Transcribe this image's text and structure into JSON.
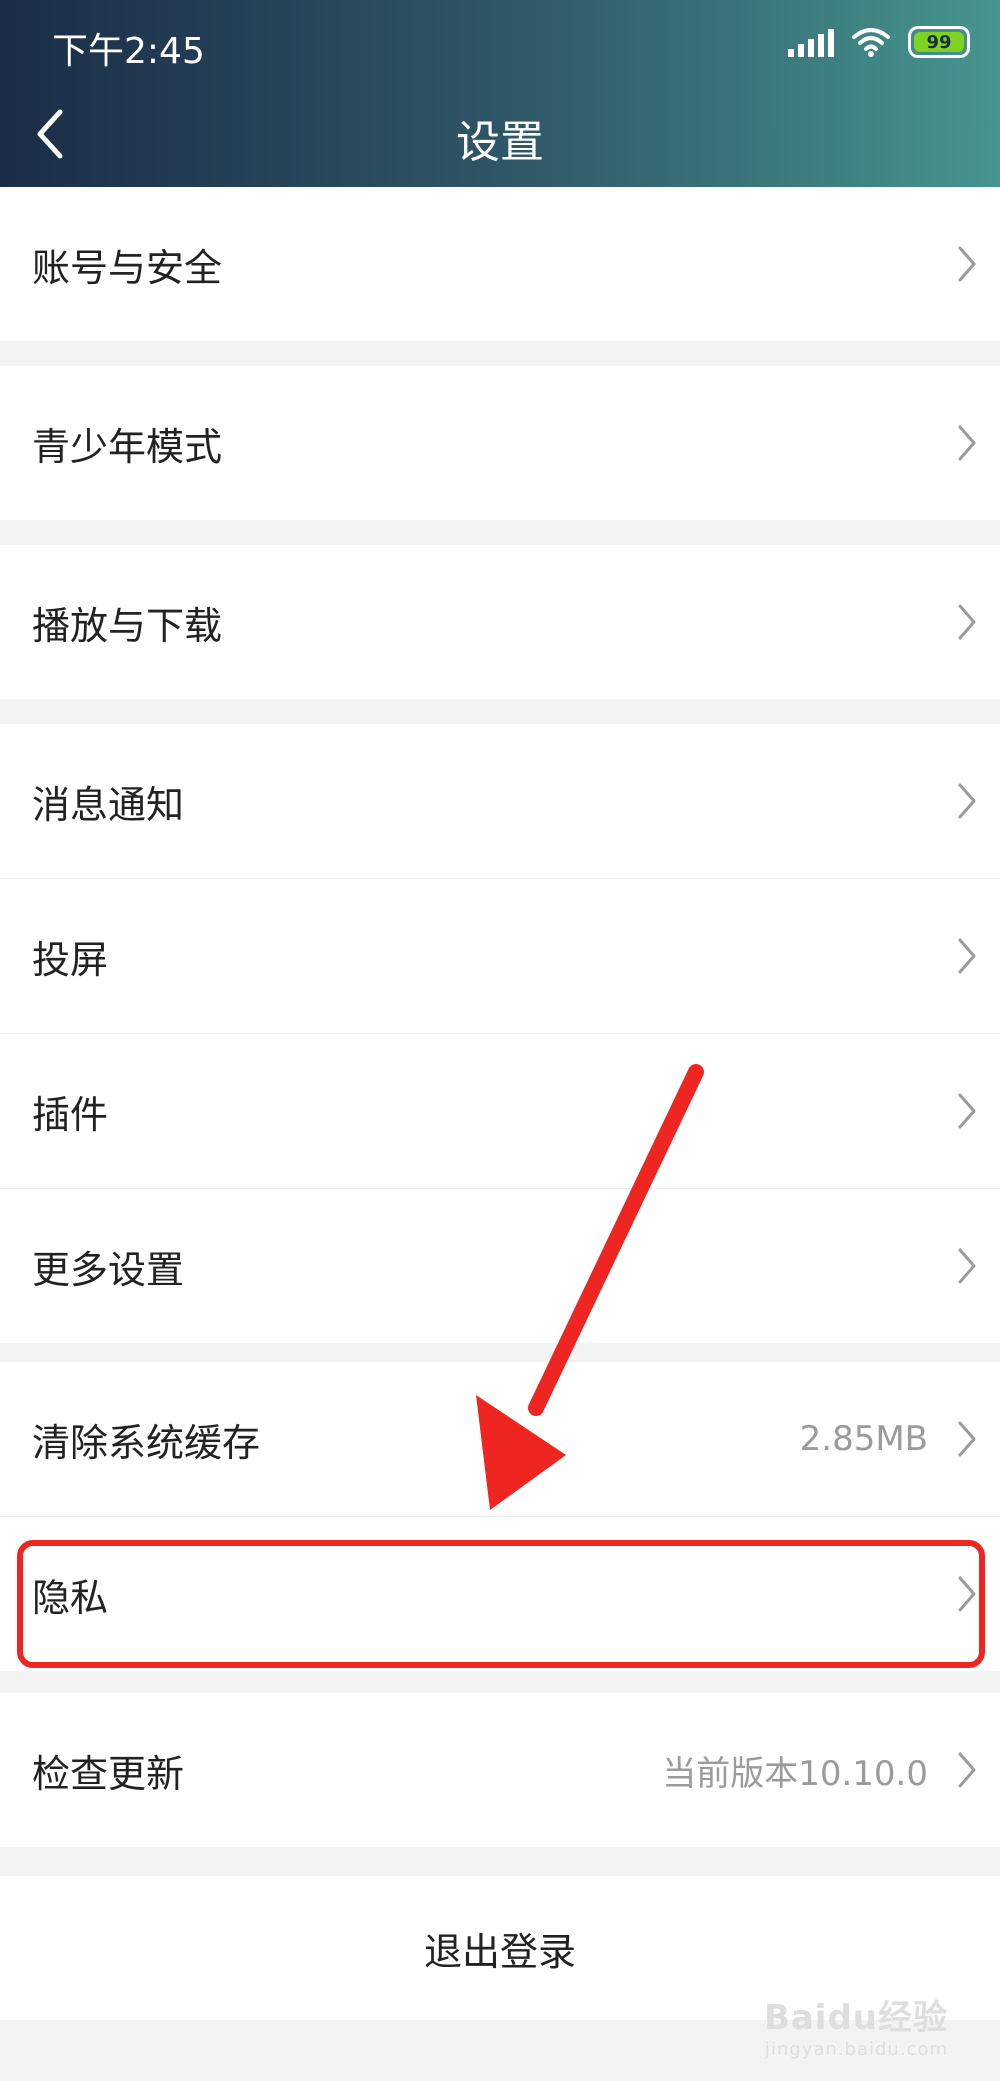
{
  "status_bar": {
    "time": "下午2:45",
    "battery": "99"
  },
  "header": {
    "title": "设置"
  },
  "groups": [
    {
      "items": [
        {
          "label": "账号与安全"
        }
      ]
    },
    {
      "items": [
        {
          "label": "青少年模式"
        }
      ]
    },
    {
      "items": [
        {
          "label": "播放与下载"
        }
      ]
    },
    {
      "items": [
        {
          "label": "消息通知"
        },
        {
          "label": "投屏"
        },
        {
          "label": "插件"
        },
        {
          "label": "更多设置"
        }
      ]
    },
    {
      "items": [
        {
          "label": "清除系统缓存",
          "value": "2.85MB"
        },
        {
          "label": "隐私"
        }
      ]
    },
    {
      "items": [
        {
          "label": "检查更新",
          "value": "当前版本10.10.0"
        }
      ]
    }
  ],
  "logout": {
    "label": "退出登录"
  },
  "watermark": {
    "brand": "Baidu经验",
    "url": "jingyan.baidu.com"
  },
  "colors": {
    "highlight": "#ee2520",
    "header_start": "#1b2c47",
    "header_end": "#46958f",
    "battery": "#7ed321"
  }
}
